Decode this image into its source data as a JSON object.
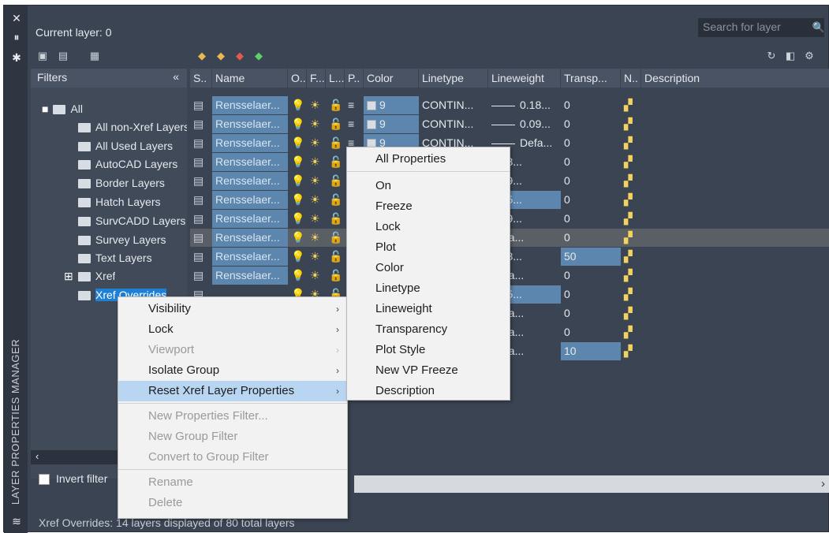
{
  "window": {
    "vertical_title": "LAYER PROPERTIES MANAGER",
    "current_layer": "Current layer: 0",
    "search_placeholder": "Search for layer",
    "status_text": "Xref Overrides: 14 layers displayed of 80 total layers"
  },
  "filters": {
    "header": "Filters",
    "collapse_glyph": "«",
    "invert_filter_label": "Invert filter",
    "tree": [
      {
        "label": "All",
        "level": 0
      },
      {
        "label": "All non-Xref Layers",
        "level": 1
      },
      {
        "label": "All Used Layers",
        "level": 1
      },
      {
        "label": "AutoCAD Layers",
        "level": 1
      },
      {
        "label": "Border Layers",
        "level": 1
      },
      {
        "label": "Hatch Layers",
        "level": 1
      },
      {
        "label": "SurvCADD Layers",
        "level": 1
      },
      {
        "label": "Survey Layers",
        "level": 1
      },
      {
        "label": "Text Layers",
        "level": 1
      },
      {
        "label": "Xref",
        "level": 1
      },
      {
        "label": "Xref Overrides",
        "level": 1,
        "selected": true
      }
    ]
  },
  "grid": {
    "columns": [
      "S..",
      "Name",
      "O..",
      "F...",
      "L...",
      "P..",
      "Color",
      "Linetype",
      "Lineweight",
      "Transp...",
      "N..",
      "Description"
    ],
    "rows": [
      {
        "name": "Rensselaer...",
        "color": "9",
        "linetype": "CONTIN...",
        "lineweight": "0.18...",
        "transp": "0"
      },
      {
        "name": "Rensselaer...",
        "color": "9",
        "linetype": "CONTIN...",
        "lineweight": "0.09...",
        "transp": "0"
      },
      {
        "name": "Rensselaer...",
        "color": "9",
        "linetype": "CONTIN...",
        "lineweight": "Defa...",
        "transp": "0"
      },
      {
        "name": "Rensselaer...",
        "color": "",
        "linetype": "",
        "lineweight": "0.18...",
        "transp": "0"
      },
      {
        "name": "Rensselaer...",
        "color": "",
        "linetype": "",
        "lineweight": "0.09...",
        "transp": "0"
      },
      {
        "name": "Rensselaer...",
        "color": "",
        "linetype": "",
        "lineweight": "0.25...",
        "transp": "0"
      },
      {
        "name": "Rensselaer...",
        "color": "",
        "linetype": "",
        "lineweight": "0.09...",
        "transp": "0"
      },
      {
        "name": "Rensselaer...",
        "color": "",
        "linetype": "",
        "lineweight": "Defa...",
        "transp": "0"
      },
      {
        "name": "Rensselaer...",
        "color": "",
        "linetype": "",
        "lineweight": "0.18...",
        "transp": "50"
      },
      {
        "name": "Rensselaer...",
        "color": "",
        "linetype": "",
        "lineweight": "Defa...",
        "transp": "0"
      },
      {
        "name": "",
        "color": "",
        "linetype": "",
        "lineweight": "0.35...",
        "transp": "0"
      },
      {
        "name": "",
        "color": "",
        "linetype": "",
        "lineweight": "Defa...",
        "transp": "0"
      },
      {
        "name": "",
        "color": "",
        "linetype": "",
        "lineweight": "Defa...",
        "transp": "0"
      },
      {
        "name": "",
        "color": "",
        "linetype": "",
        "lineweight": "Defa...",
        "transp": "10"
      }
    ]
  },
  "context_menu": {
    "items": [
      "Visibility",
      "Lock",
      "Viewport",
      "Isolate Group",
      "Reset Xref Layer Properties",
      "New Properties Filter...",
      "New Group Filter",
      "Convert to Group Filter",
      "Rename",
      "Delete"
    ]
  },
  "submenu": {
    "items": [
      "All Properties",
      "On",
      "Freeze",
      "Lock",
      "Plot",
      "Color",
      "Linetype",
      "Lineweight",
      "Transparency",
      "Plot Style",
      "New VP Freeze",
      "Description"
    ]
  }
}
